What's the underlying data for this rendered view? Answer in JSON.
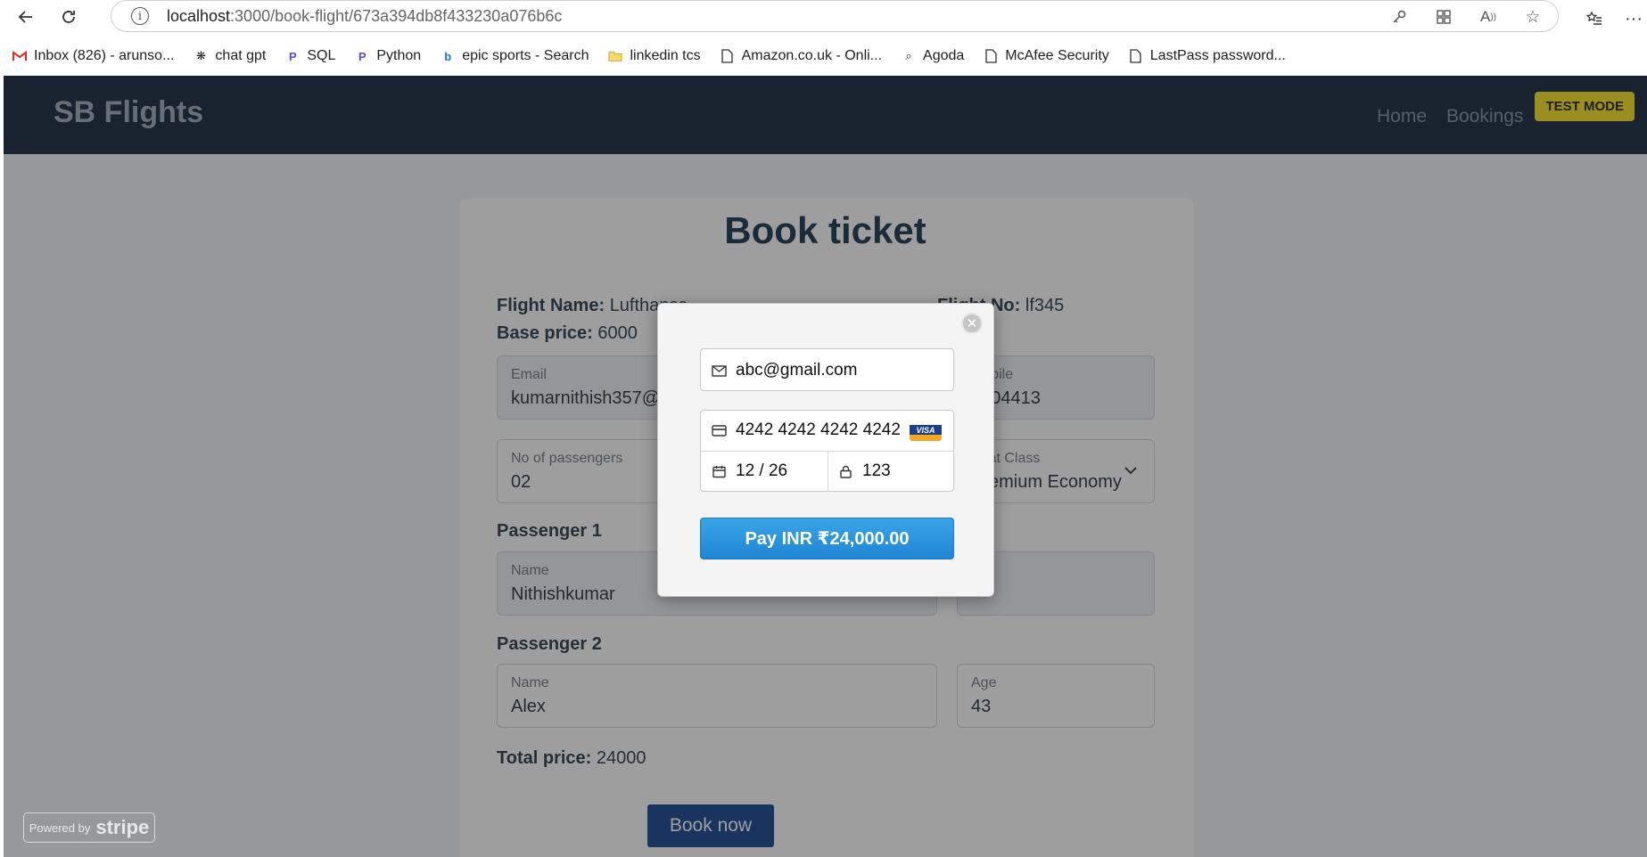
{
  "browser": {
    "url_host": "localhost",
    "url_path": ":3000/book-flight/673a394db8f433230a076b6c",
    "bookmarks": [
      {
        "label": "Inbox (826) - arunso...",
        "icon": "gmail-icon"
      },
      {
        "label": "chat gpt",
        "icon": "openai-icon"
      },
      {
        "label": "SQL",
        "icon": "perplexity-icon"
      },
      {
        "label": "Python",
        "icon": "perplexity-icon"
      },
      {
        "label": "epic sports - Search",
        "icon": "bing-icon"
      },
      {
        "label": "linkedin tcs",
        "icon": "folder-icon"
      },
      {
        "label": "Amazon.co.uk - Onli...",
        "icon": "page-icon"
      },
      {
        "label": "Agoda",
        "icon": "agoda-icon"
      },
      {
        "label": "McAfee Security",
        "icon": "page-icon"
      },
      {
        "label": "LastPass password...",
        "icon": "page-icon"
      }
    ]
  },
  "navbar": {
    "brand": "SB Flights",
    "links": [
      "Home",
      "Bookings"
    ],
    "test_mode": "TEST MODE"
  },
  "booking": {
    "title": "Book ticket",
    "flight_name_label": "Flight Name:",
    "flight_name_value": "Lufthansa",
    "flight_no_label": "Flight No:",
    "flight_no_value": "lf345",
    "base_price_label": "Base price:",
    "base_price_value": "6000",
    "email_label": "Email",
    "email_value": "kumarnithish357@gmail.com",
    "mobile_label": "Mobile",
    "mobile_value": "9904413",
    "passengers_label": "No of passengers",
    "passengers_value": "02",
    "class_label": "Seat Class",
    "class_value": "Premium Economy",
    "passenger1_heading": "Passenger 1",
    "passenger1_name_label": "Name",
    "passenger1_name_value": "Nithishkumar",
    "passenger2_heading": "Passenger 2",
    "passenger2_name_label": "Name",
    "passenger2_name_value": "Alex",
    "passenger2_age_label": "Age",
    "passenger2_age_value": "43",
    "total_label": "Total price:",
    "total_value": "24000",
    "book_button": "Book now"
  },
  "stripe": {
    "powered_by": "Powered by",
    "brand": "stripe",
    "email": "abc@gmail.com",
    "card_number": "4242 4242 4242 4242",
    "card_brand": "VISA",
    "expiry": "12 / 26",
    "cvc": "123",
    "pay_button": "Pay INR ₹24,000.00",
    "close_symbol": "✕"
  }
}
